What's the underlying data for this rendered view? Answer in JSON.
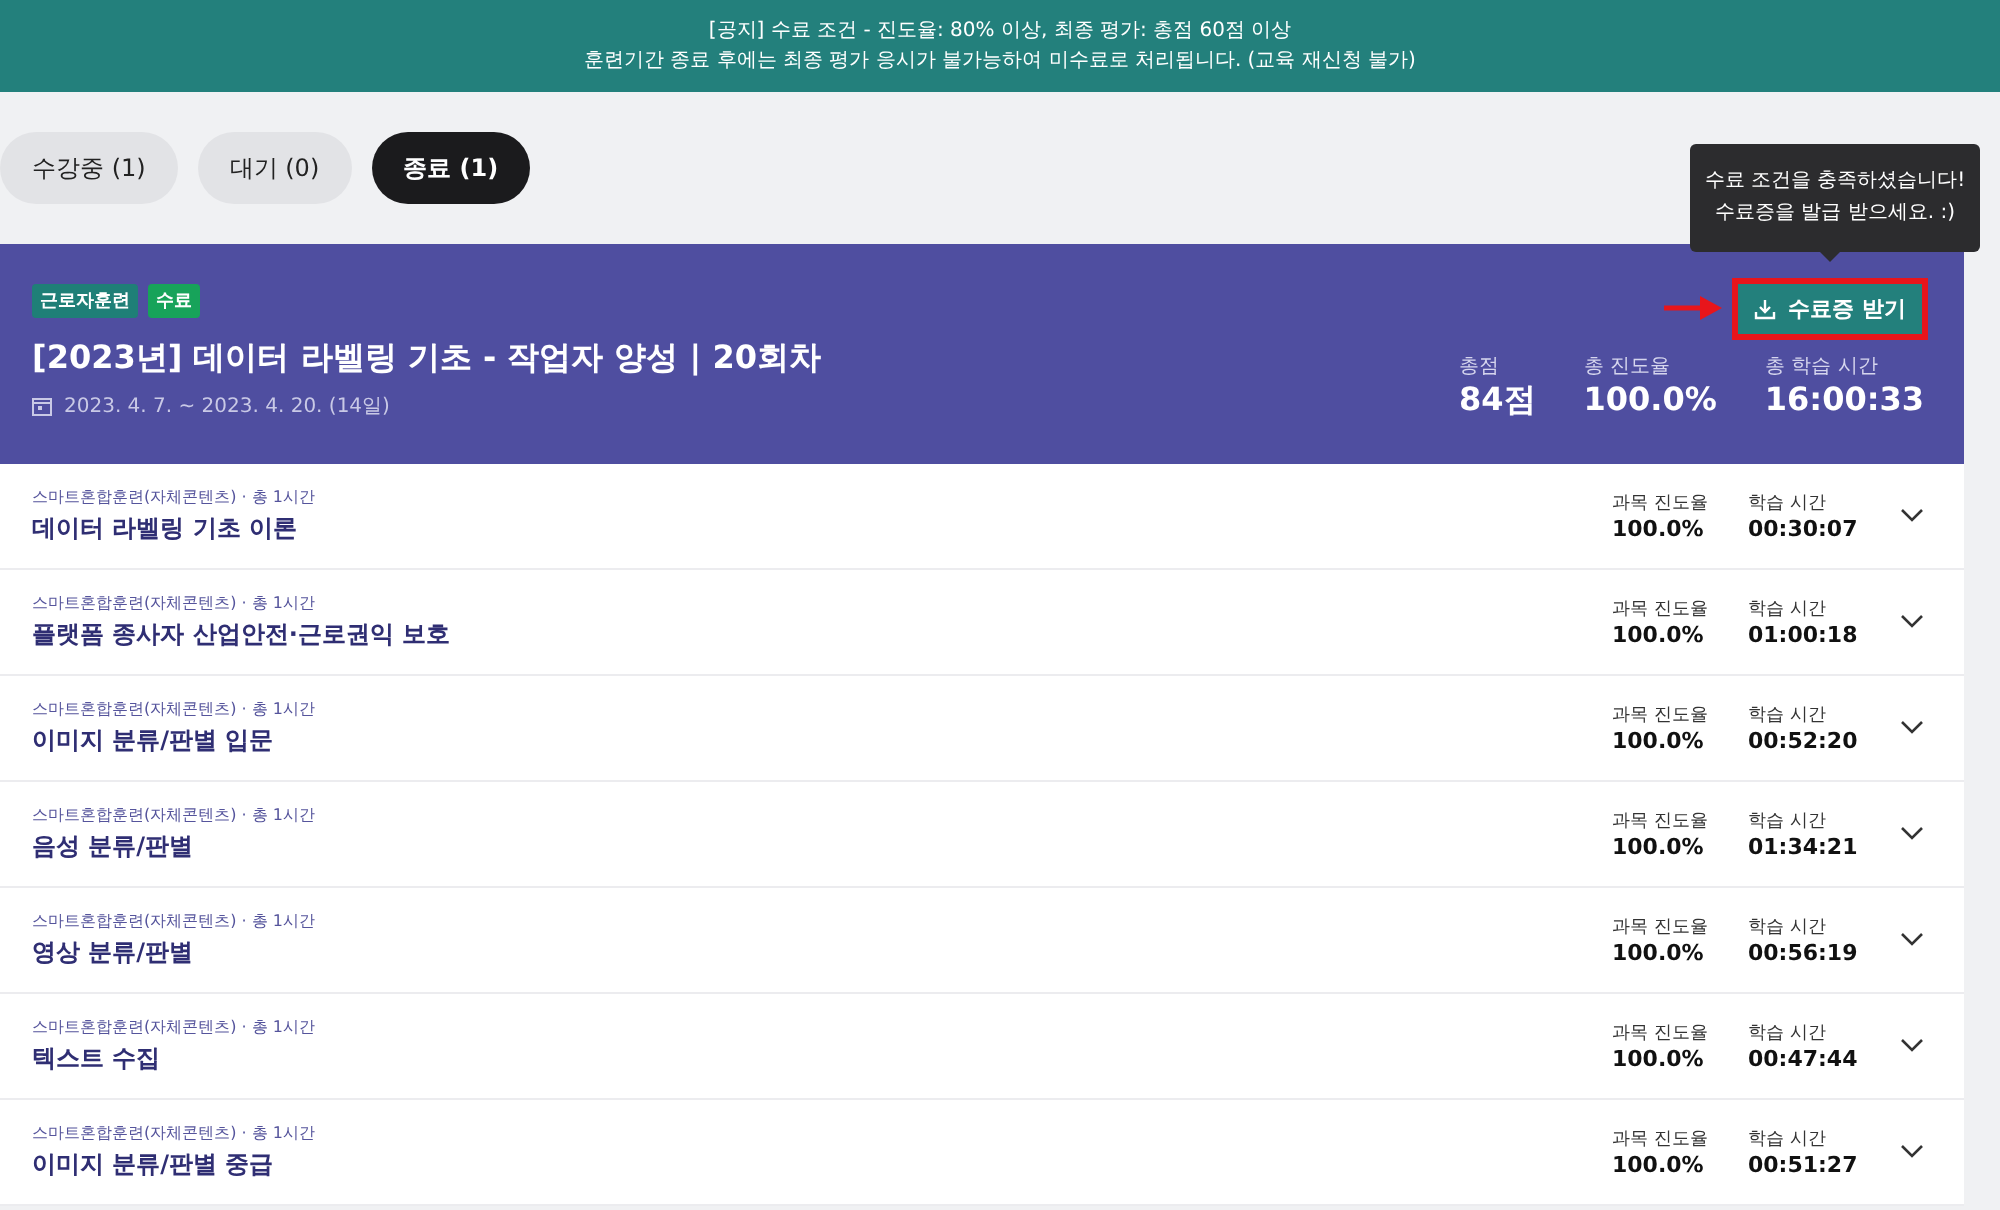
{
  "notice": {
    "lines": [
      "[공지] 수료 조건 - 진도율: 80% 이상, 최종 평가: 총점 60점 이상",
      "훈련기간 종료 후에는 최종 평가 응시가 불가능하여 미수료로 처리됩니다. (교육 재신청 불가)"
    ]
  },
  "tabs": [
    {
      "label": "수강중 (1)",
      "selected": false
    },
    {
      "label": "대기 (0)",
      "selected": false
    },
    {
      "label": "종료 (1)",
      "selected": true
    }
  ],
  "tooltip": {
    "lines": [
      "수료 조건을 충족하셨습니다!",
      "수료증을 발급 받으세요. :)"
    ]
  },
  "course": {
    "badges": [
      {
        "label": "근로자훈련",
        "color": "#1f7f77"
      },
      {
        "label": "수료",
        "color": "#17a35a"
      }
    ],
    "title": "[2023년] 데이터 라벨링 기초 - 작업자 양성 | 20회차",
    "period": "2023. 4. 7. ~ 2023. 4. 20. (14일)",
    "certificate_button": "수료증 받기",
    "stats": [
      {
        "label": "총점",
        "value": "84점"
      },
      {
        "label": "총 진도율",
        "value": "100.0%"
      },
      {
        "label": "총 학습 시간",
        "value": "16:00:33"
      }
    ]
  },
  "subjects": [
    {
      "category": "스마트혼합훈련(자체콘텐츠) · 총 1시간",
      "title": "데이터 라벨링 기초 이론",
      "progress_label": "과목 진도율",
      "progress": "100.0%",
      "time_label": "학습 시간",
      "time": "00:30:07",
      "expanded": false
    },
    {
      "category": "스마트혼합훈련(자체콘텐츠) · 총 1시간",
      "title": "플랫폼 종사자 산업안전·근로권익 보호",
      "progress_label": "과목 진도율",
      "progress": "100.0%",
      "time_label": "학습 시간",
      "time": "01:00:18",
      "expanded": false
    },
    {
      "category": "스마트혼합훈련(자체콘텐츠) · 총 1시간",
      "title": "이미지 분류/판별 입문",
      "progress_label": "과목 진도율",
      "progress": "100.0%",
      "time_label": "학습 시간",
      "time": "00:52:20",
      "expanded": false
    },
    {
      "category": "스마트혼합훈련(자체콘텐츠) · 총 1시간",
      "title": "음성 분류/판별",
      "progress_label": "과목 진도율",
      "progress": "100.0%",
      "time_label": "학습 시간",
      "time": "01:34:21",
      "expanded": false
    },
    {
      "category": "스마트혼합훈련(자체콘텐츠) · 총 1시간",
      "title": "영상 분류/판별",
      "progress_label": "과목 진도율",
      "progress": "100.0%",
      "time_label": "학습 시간",
      "time": "00:56:19",
      "expanded": false
    },
    {
      "category": "스마트혼합훈련(자체콘텐츠) · 총 1시간",
      "title": "텍스트 수집",
      "progress_label": "과목 진도율",
      "progress": "100.0%",
      "time_label": "학습 시간",
      "time": "00:47:44",
      "expanded": false
    },
    {
      "category": "스마트혼합훈련(자체콘텐츠) · 총 1시간",
      "title": "이미지 분류/판별 중급",
      "progress_label": "과목 진도율",
      "progress": "100.0%",
      "time_label": "학습 시간",
      "time": "00:51:27",
      "expanded": false
    }
  ]
}
